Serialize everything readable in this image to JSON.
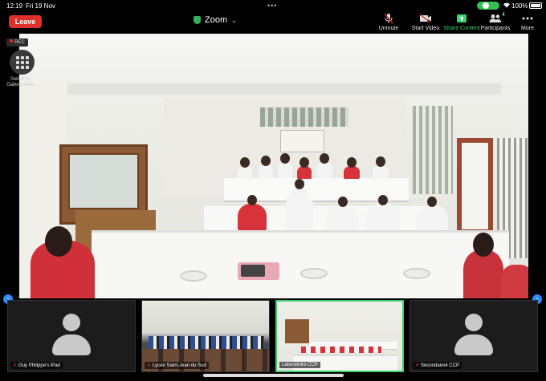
{
  "status_bar": {
    "time": "12:19",
    "date": "Fri 19 Nov",
    "battery": "100%"
  },
  "toolbar": {
    "leave_label": "Leave",
    "meeting_title": "Zoom",
    "unmute_label": "Unmute",
    "start_video_label": "Start Video",
    "share_content_label": "Share Content",
    "participants_label": "Participants",
    "participants_count": "4",
    "more_label": "More"
  },
  "overlay": {
    "rec_label": "REC",
    "gallery_label": "Switch to Gallery View"
  },
  "thumbnails": [
    {
      "name": "Guy Philippe's iPad",
      "video": false
    },
    {
      "name": "Lycée Saint-Jean du Sud",
      "video": true
    },
    {
      "name": "Laboratoire CCP",
      "video": true
    },
    {
      "name": "Secondaire4 CCP",
      "video": false
    }
  ],
  "colors": {
    "leave": "#e0302b",
    "share_accent": "#3bd36d",
    "active_speaker_border": "#3ed36e",
    "nav_bubble": "#2d8cff"
  }
}
